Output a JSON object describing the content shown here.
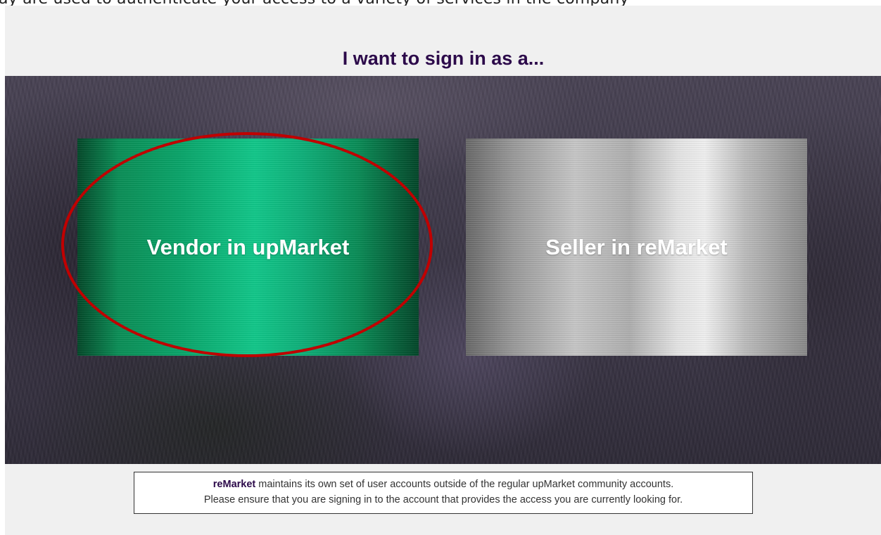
{
  "top_strip_text": "ay are used to authenticate your access to a variety of services in the company",
  "heading": "I want to sign in as a...",
  "cards": [
    {
      "label": "Vendor in upMarket",
      "color": "#0aa56a",
      "highlighted": true
    },
    {
      "label": "Seller in reMarket",
      "color": "#c8c8c8",
      "highlighted": false
    }
  ],
  "notice": {
    "brand": "reMarket",
    "line1_rest": " maintains its own set of user accounts outside of the regular upMarket community accounts.",
    "line2": "Please ensure that you are signing in to the account that provides the access you are currently looking for."
  },
  "colors": {
    "heading": "#2c0a4a",
    "highlight_ring": "#c00000",
    "page_bg": "#f0f0f0"
  }
}
